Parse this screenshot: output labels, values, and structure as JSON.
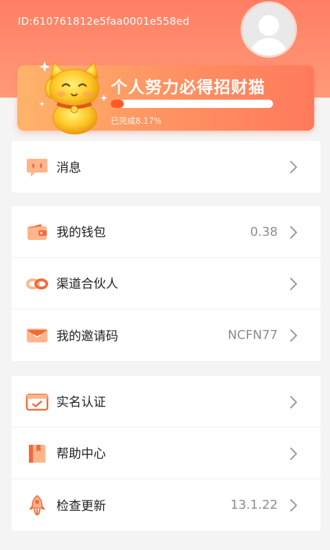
{
  "header": {
    "user_id": "ID:610761812e5faa0001e558ed"
  },
  "task": {
    "title": "个人努力必得招财猫",
    "progress_label": "已完成8.17%",
    "progress_fraction": 0.0817
  },
  "colors": {
    "header_top": "#ff7e63",
    "accent": "#ff7a47",
    "progress_fill": "#ff5a2a"
  },
  "groups": [
    {
      "items": [
        {
          "key": "messages",
          "label": "消息",
          "value": "",
          "icon": "chat-bubble-icon"
        }
      ]
    },
    {
      "items": [
        {
          "key": "wallet",
          "label": "我的钱包",
          "value": "0.38",
          "icon": "wallet-icon"
        },
        {
          "key": "partner",
          "label": "渠道合伙人",
          "value": "",
          "icon": "link-icon"
        },
        {
          "key": "invite",
          "label": "我的邀请码",
          "value": "NCFN77",
          "icon": "envelope-icon"
        }
      ]
    },
    {
      "items": [
        {
          "key": "verify",
          "label": "实名认证",
          "value": "",
          "icon": "id-card-icon"
        },
        {
          "key": "help",
          "label": "帮助中心",
          "value": "",
          "icon": "book-icon"
        },
        {
          "key": "update",
          "label": "检查更新",
          "value": "13.1.22",
          "icon": "rocket-icon"
        }
      ]
    }
  ]
}
